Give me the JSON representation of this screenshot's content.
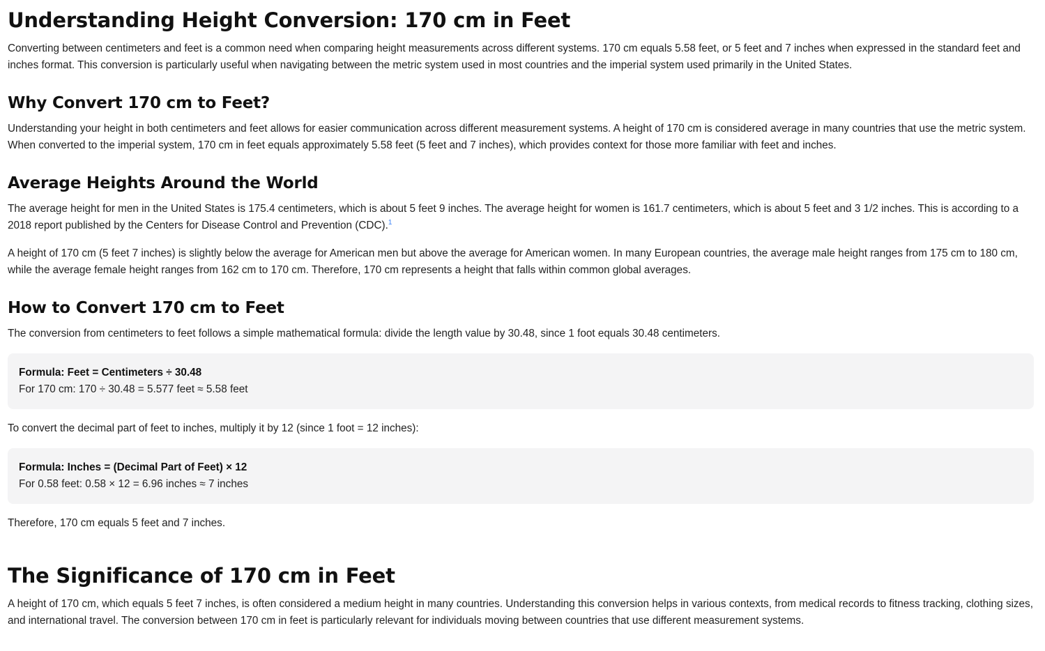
{
  "title": "Understanding Height Conversion: 170 cm in Feet",
  "intro": "Converting between centimeters and feet is a common need when comparing height measurements across different systems. 170 cm equals 5.58 feet, or 5 feet and 7 inches when expressed in the standard feet and inches format. This conversion is particularly useful when navigating between the metric system used in most countries and the imperial system used primarily in the United States.",
  "why": {
    "heading": "Why Convert 170 cm to Feet?",
    "text": "Understanding your height in both centimeters and feet allows for easier communication across different measurement systems. A height of 170 cm is considered average in many countries that use the metric system. When converted to the imperial system, 170 cm in feet equals approximately 5.58 feet (5 feet and 7 inches), which provides context for those more familiar with feet and inches."
  },
  "average": {
    "heading": "Average Heights Around the World",
    "text1": "The average height for men in the United States is 175.4 centimeters, which is about 5 feet 9 inches. The average height for women is 161.7 centimeters, which is about 5 feet and 3 1/2 inches. This is according to a 2018 report published by the Centers for Disease Control and Prevention (CDC).",
    "footnote": "1",
    "text2": "A height of 170 cm (5 feet 7 inches) is slightly below the average for American men but above the average for American women. In many European countries, the average male height ranges from 175 cm to 180 cm, while the average female height ranges from 162 cm to 170 cm. Therefore, 170 cm represents a height that falls within common global averages."
  },
  "howto": {
    "heading": "How to Convert 170 cm to Feet",
    "text1": "The conversion from centimeters to feet follows a simple mathematical formula: divide the length value by 30.48, since 1 foot equals 30.48 centimeters.",
    "formula1_label": "Formula: Feet = Centimeters ÷ 30.48",
    "formula1_example": "For 170 cm: 170 ÷ 30.48 = 5.577 feet ≈ 5.58 feet",
    "text2": "To convert the decimal part of feet to inches, multiply it by 12 (since 1 foot = 12 inches):",
    "formula2_label": "Formula: Inches = (Decimal Part of Feet) × 12",
    "formula2_example": "For 0.58 feet: 0.58 × 12 = 6.96 inches ≈ 7 inches",
    "text3": "Therefore, 170 cm equals 5 feet and 7 inches."
  },
  "significance": {
    "heading": "The Significance of 170 cm in Feet",
    "text": "A height of 170 cm, which equals 5 feet 7 inches, is often considered a medium height in many countries. Understanding this conversion helps in various contexts, from medical records to fitness tracking, clothing sizes, and international travel. The conversion between 170 cm in feet is particularly relevant for individuals moving between countries that use different measurement systems."
  }
}
